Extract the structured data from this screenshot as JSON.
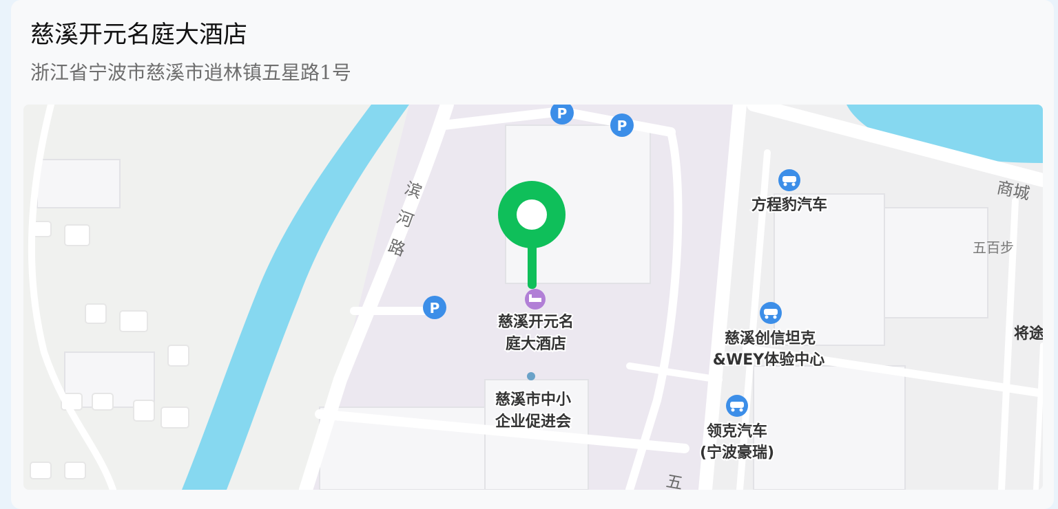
{
  "poi": {
    "name": "慈溪开元名庭大酒店",
    "address": "浙江省宁波市慈溪市逍林镇五星路1号"
  },
  "map": {
    "marker_color": "#0fbf5a",
    "water_color": "#86d8f0",
    "parking_icon_color": "#3c8ee8",
    "hotel_icon_color": "#b17fd6",
    "parking_label": "P",
    "road_labels": {
      "binhe_road": [
        "滨",
        "河",
        "路"
      ],
      "shangcheng": "商城",
      "wubaibu": "五百步",
      "jiangtu": "将途",
      "wu_bottom": "五"
    },
    "places": {
      "hotel": [
        "慈溪开元名",
        "庭大酒店"
      ],
      "promotion_association": [
        "慈溪市中小",
        "企业促进会"
      ],
      "fangchengbao": [
        "方程豹汽车"
      ],
      "chuangxin_tank": [
        "慈溪创信坦克",
        "&WEY体验中心"
      ],
      "lynk_co": [
        "领克汽车",
        "(宁波豪瑞)"
      ]
    }
  }
}
